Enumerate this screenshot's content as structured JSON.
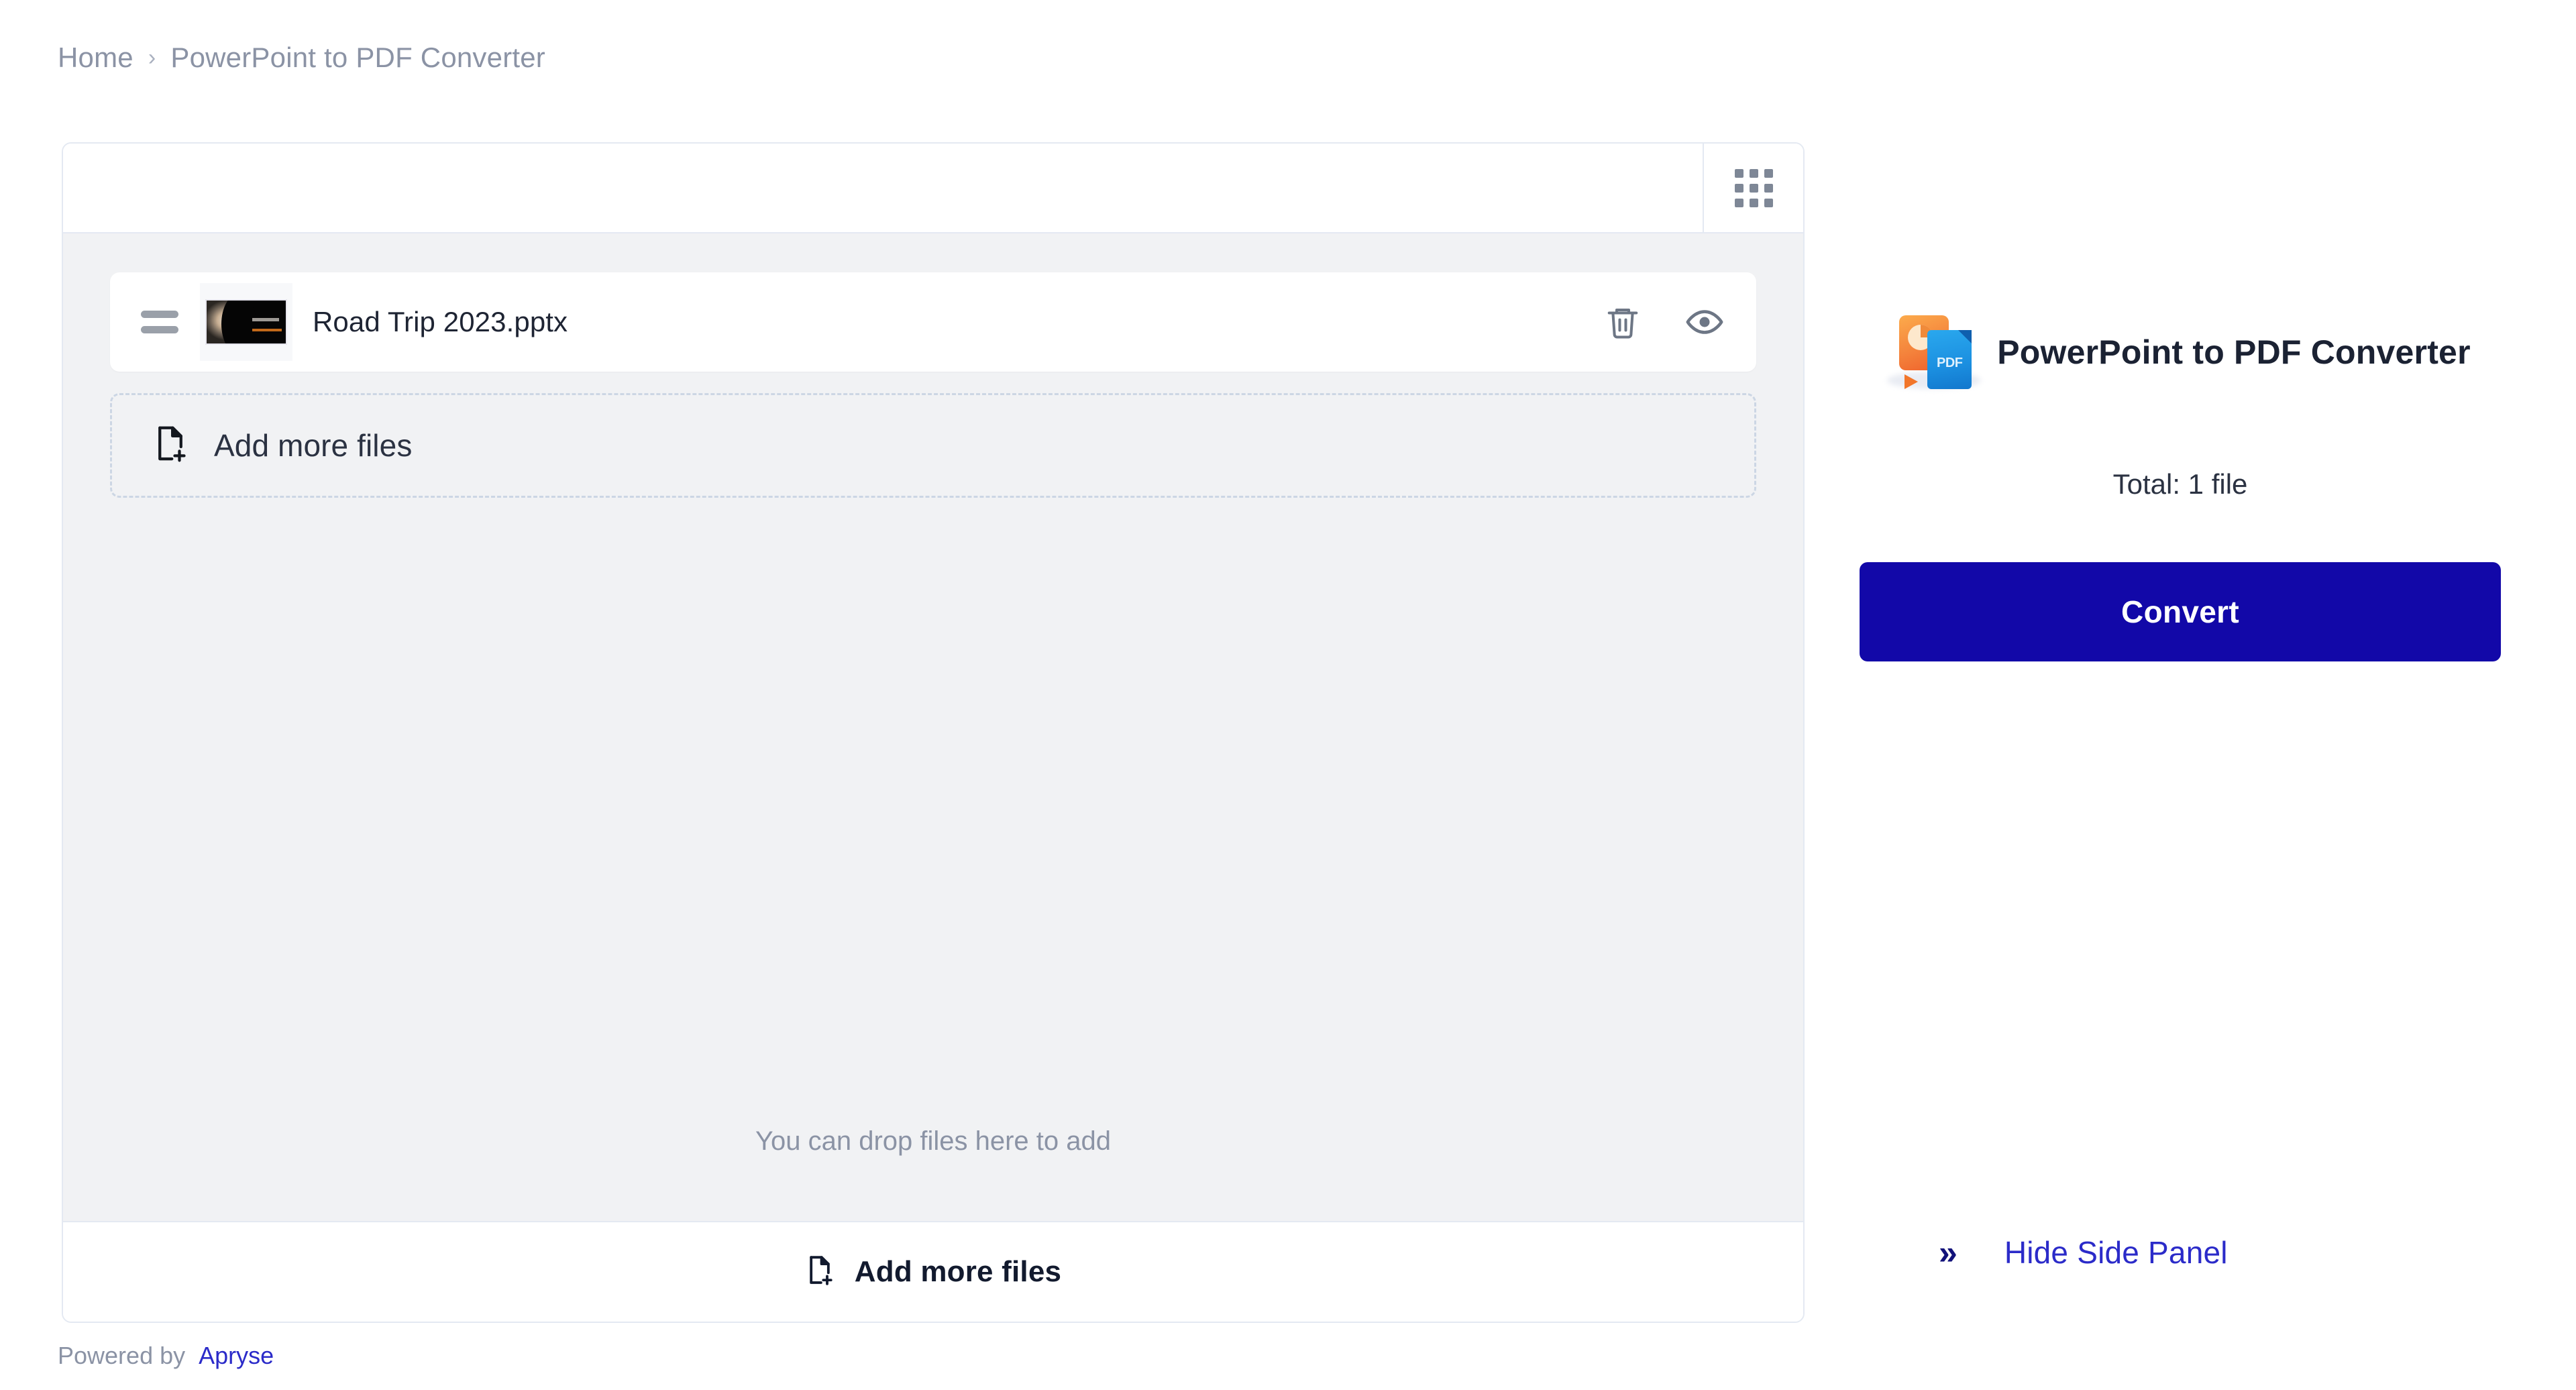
{
  "breadcrumb": {
    "home": "Home",
    "separator": "›",
    "current": "PowerPoint to PDF Converter"
  },
  "toolbar": {
    "grid_view_icon": "grid-view-icon"
  },
  "file_list": {
    "rows": [
      {
        "name": "Road Trip 2023.pptx",
        "drag_handle_icon": "drag-handle-icon",
        "thumbnail_icon": "slide-thumbnail",
        "delete_icon": "trash-icon",
        "preview_icon": "eye-icon"
      }
    ],
    "dropzone_label": "Add more files",
    "dropzone_icon": "file-add-icon",
    "drop_hint": "You can drop files here to add",
    "add_bar_label": "Add more files",
    "add_bar_icon": "file-add-icon"
  },
  "side_panel": {
    "logo_icon": "powerpoint-to-pdf-icon",
    "title": "PowerPoint to PDF Converter",
    "total": "Total: 1 file",
    "convert_label": "Convert",
    "hide_panel_label": "Hide Side Panel",
    "hide_panel_icon": "chevron-double-right-icon",
    "ppt_badge": "P",
    "pdf_badge": "PDF"
  },
  "footer": {
    "powered_by": "Powered by",
    "brand": "Apryse"
  },
  "colors": {
    "accent_blue": "#1208a8",
    "link_blue": "#2b2bc9",
    "muted_text": "#8b93a5",
    "list_bg": "#f1f2f4",
    "border": "#e4e9f2"
  }
}
